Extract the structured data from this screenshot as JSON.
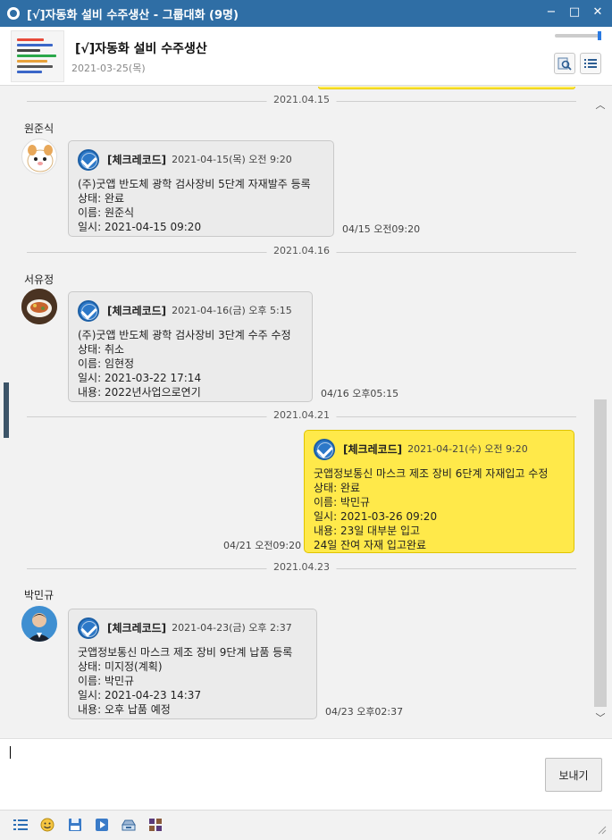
{
  "window": {
    "title": "[√]자동화 설비 수주생산 - 그룹대화 (9명)",
    "minimize": "−",
    "maximize": "□",
    "close": "✕"
  },
  "header": {
    "room_name": "[√]자동화 설비 수주생산",
    "room_date": "2021-03-25(목)",
    "search_icon": "search-doc-icon",
    "menu_icon": "list-menu-icon"
  },
  "chat": {
    "dates": [
      "2021.04.15",
      "2021.04.16",
      "2021.04.21",
      "2021.04.23"
    ],
    "messages": [
      {
        "sender": "원준식",
        "tag": "[체크레코드]",
        "meta": "2021-04-15(목) 오전 9:20",
        "lines": [
          "(주)굿앱 반도체 광학 검사장비 5단계 자재발주 등록",
          "상태: 완료",
          "이름: 원준식",
          "일시: 2021-04-15 09:20"
        ],
        "time": "04/15 오전09:20"
      },
      {
        "sender": "서유정",
        "tag": "[체크레코드]",
        "meta": "2021-04-16(금) 오후 5:15",
        "lines": [
          "(주)굿앱 반도체 광학 검사장비 3단계 수주 수정",
          "상태: 취소",
          "이름: 임현정",
          "일시: 2021-03-22 17:14",
          "내용: 2022년사업으로연기"
        ],
        "time": "04/16 오후05:15"
      },
      {
        "sender": "",
        "tag": "[체크레코드]",
        "meta": "2021-04-21(수) 오전 9:20",
        "lines": [
          "굿앱정보통신 마스크 제조 장비 6단계 자재입고 수정",
          "상태: 완료",
          "이름: 박민규",
          "일시: 2021-03-26 09:20",
          "내용: 23일 대부분 입고",
          "24일 잔여 자재 입고완료"
        ],
        "time": "04/21 오전09:20"
      },
      {
        "sender": "박민규",
        "tag": "[체크레코드]",
        "meta": "2021-04-23(금) 오후 2:37",
        "lines": [
          "굿앱정보통신 마스크 제조 장비 9단계 납품 등록",
          "상태: 미지정(계획)",
          "이름: 박민규",
          "일시: 2021-04-23 14:37",
          "내용: 오후 납품 예정"
        ],
        "time": "04/23 오후02:37"
      }
    ]
  },
  "input": {
    "send_label": "보내기"
  },
  "toolbar": {
    "icons": [
      "list-icon",
      "emoji-icon",
      "save-icon",
      "play-icon",
      "archive-icon",
      "grid-icon"
    ]
  },
  "colors": {
    "titlebar": "#2f6ea5",
    "my_bubble": "#ffe94a",
    "other_bubble": "#ebebeb",
    "check_blue": "#2c78c8"
  }
}
